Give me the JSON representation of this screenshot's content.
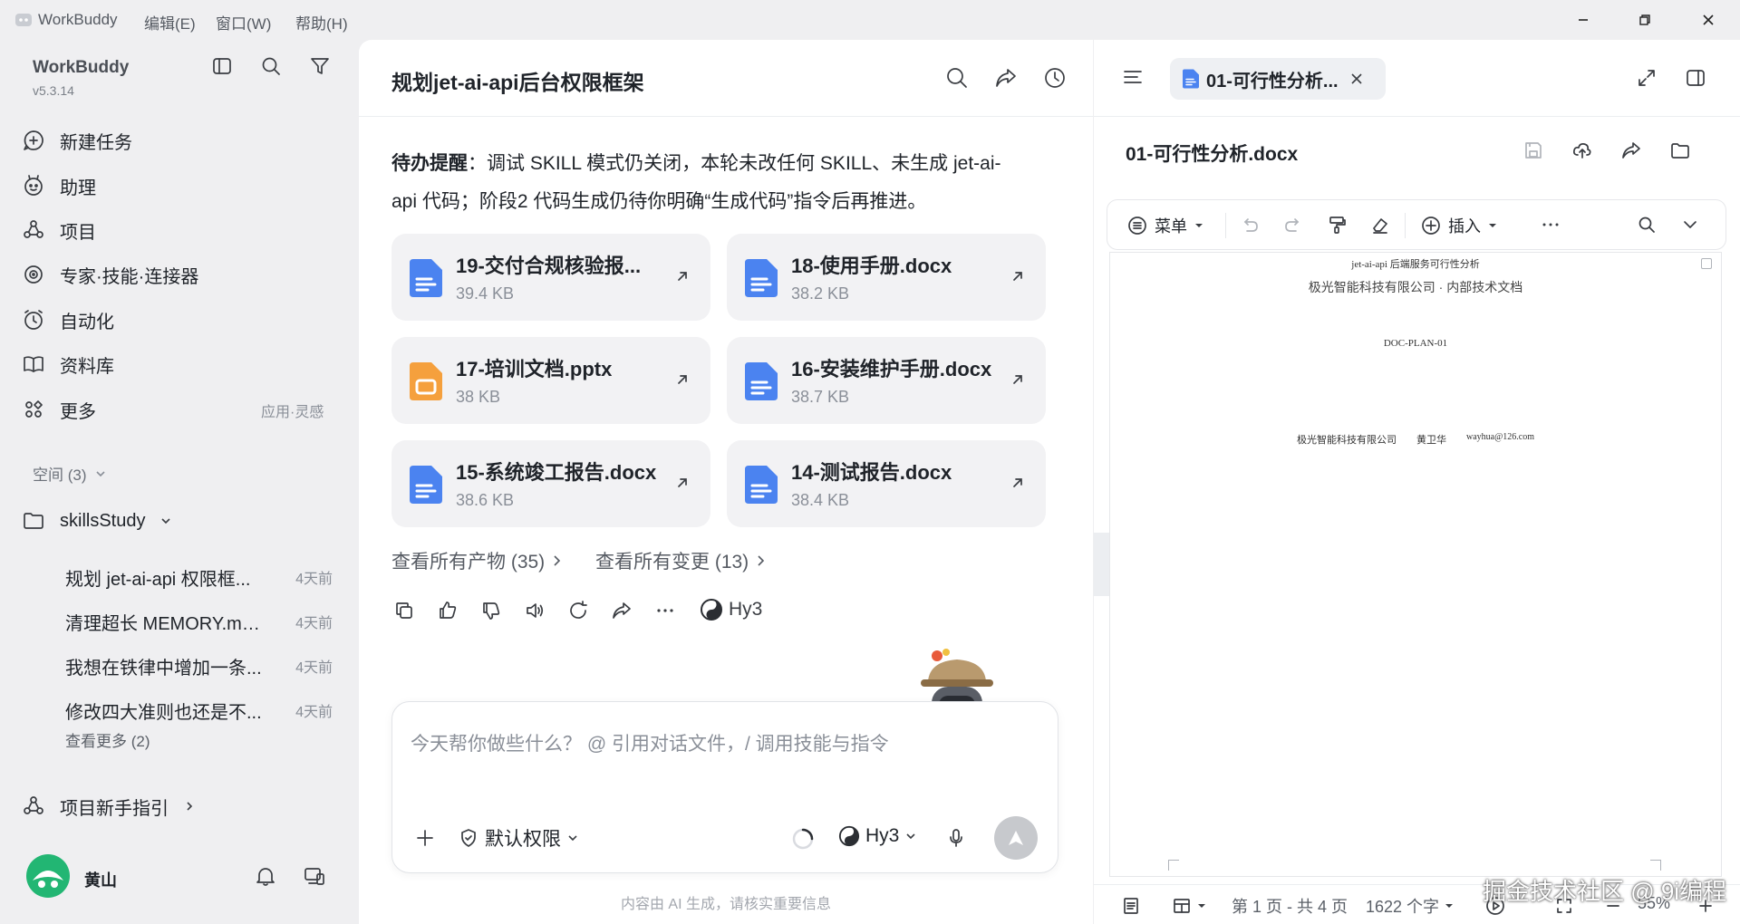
{
  "titlebar": {
    "app_name": "WorkBuddy",
    "menus": [
      "编辑(E)",
      "窗口(W)",
      "帮助(H)"
    ]
  },
  "sidebar": {
    "app_name": "WorkBuddy",
    "version": "v5.3.14",
    "nav": [
      {
        "label": "新建任务",
        "icon": "new-task-icon"
      },
      {
        "label": "助理",
        "icon": "assistant-icon"
      },
      {
        "label": "项目",
        "icon": "project-icon"
      },
      {
        "label": "专家·技能·连接器",
        "icon": "expert-icon"
      },
      {
        "label": "自动化",
        "icon": "automation-icon"
      },
      {
        "label": "资料库",
        "icon": "library-icon"
      },
      {
        "label": "更多",
        "icon": "more-grid-icon"
      }
    ],
    "more_hint": "应用·灵感",
    "space_label": "空间 (3)",
    "workspace": "skillsStudy",
    "recent": [
      {
        "title": "规划 jet-ai-api 权限框...",
        "date": "4天前"
      },
      {
        "title": "清理超长 MEMORY.md ...",
        "date": "4天前"
      },
      {
        "title": "我想在铁律中增加一条...",
        "date": "4天前"
      },
      {
        "title": "修改四大准则也还是不...",
        "date": "4天前"
      }
    ],
    "see_more": "查看更多 (2)",
    "guide": "项目新手指引",
    "user_name": "黄山"
  },
  "chat": {
    "title": "规划jet-ai-api后台权限框架",
    "reminder_label": "待办提醒",
    "reminder_line1": "：调试 SKILL 模式仍关闭，本轮未改任何 SKILL、未生成 jet-ai-",
    "reminder_line2": "api 代码；阶段2 代码生成仍待你明确“生成代码”指令后再推进。",
    "files": [
      {
        "name": "19-交付合规核验报...",
        "size": "39.4 KB",
        "type": "docx"
      },
      {
        "name": "18-使用手册.docx",
        "size": "38.2 KB",
        "type": "docx"
      },
      {
        "name": "17-培训文档.pptx",
        "size": "38 KB",
        "type": "pptx"
      },
      {
        "name": "16-安装维护手册.docx",
        "size": "38.7 KB",
        "type": "docx"
      },
      {
        "name": "15-系统竣工报告.docx",
        "size": "38.6 KB",
        "type": "docx"
      },
      {
        "name": "14-测试报告.docx",
        "size": "38.4 KB",
        "type": "docx"
      }
    ],
    "view_artifacts": "查看所有产物 (35)",
    "view_changes": "查看所有变更 (13)",
    "model_badge": "Hy3",
    "input_placeholder": "今天帮你做些什么？ @ 引用对话文件，/ 调用技能与指令",
    "permission": "默认权限",
    "model_select": "Hy3",
    "footer_note": "内容由 AI 生成，请核实重要信息"
  },
  "doc": {
    "tab_title": "01-可行性分析...",
    "file_title": "01-可行性分析.docx",
    "toolbar_menu": "菜单",
    "toolbar_insert": "插入",
    "outline": "大纲",
    "page_header": "jet-ai-api 后端服务可行性分析",
    "company_line": "极光智能科技有限公司 · 内部技术文档",
    "doc_id": "DOC-PLAN-01",
    "footer_company": "极光智能科技有限公司",
    "footer_person": "黄卫华",
    "footer_email": "wayhua@126.com",
    "page_info": "第 1 页 - 共 4 页",
    "word_count": "1622 个字",
    "zoom": "55%"
  },
  "watermark": "掘金技术社区 @ 9i编程",
  "colors": {
    "accent_blue": "#4b83f0",
    "ppt_orange": "#f5a03d",
    "send_gray": "#c7c9cd"
  }
}
